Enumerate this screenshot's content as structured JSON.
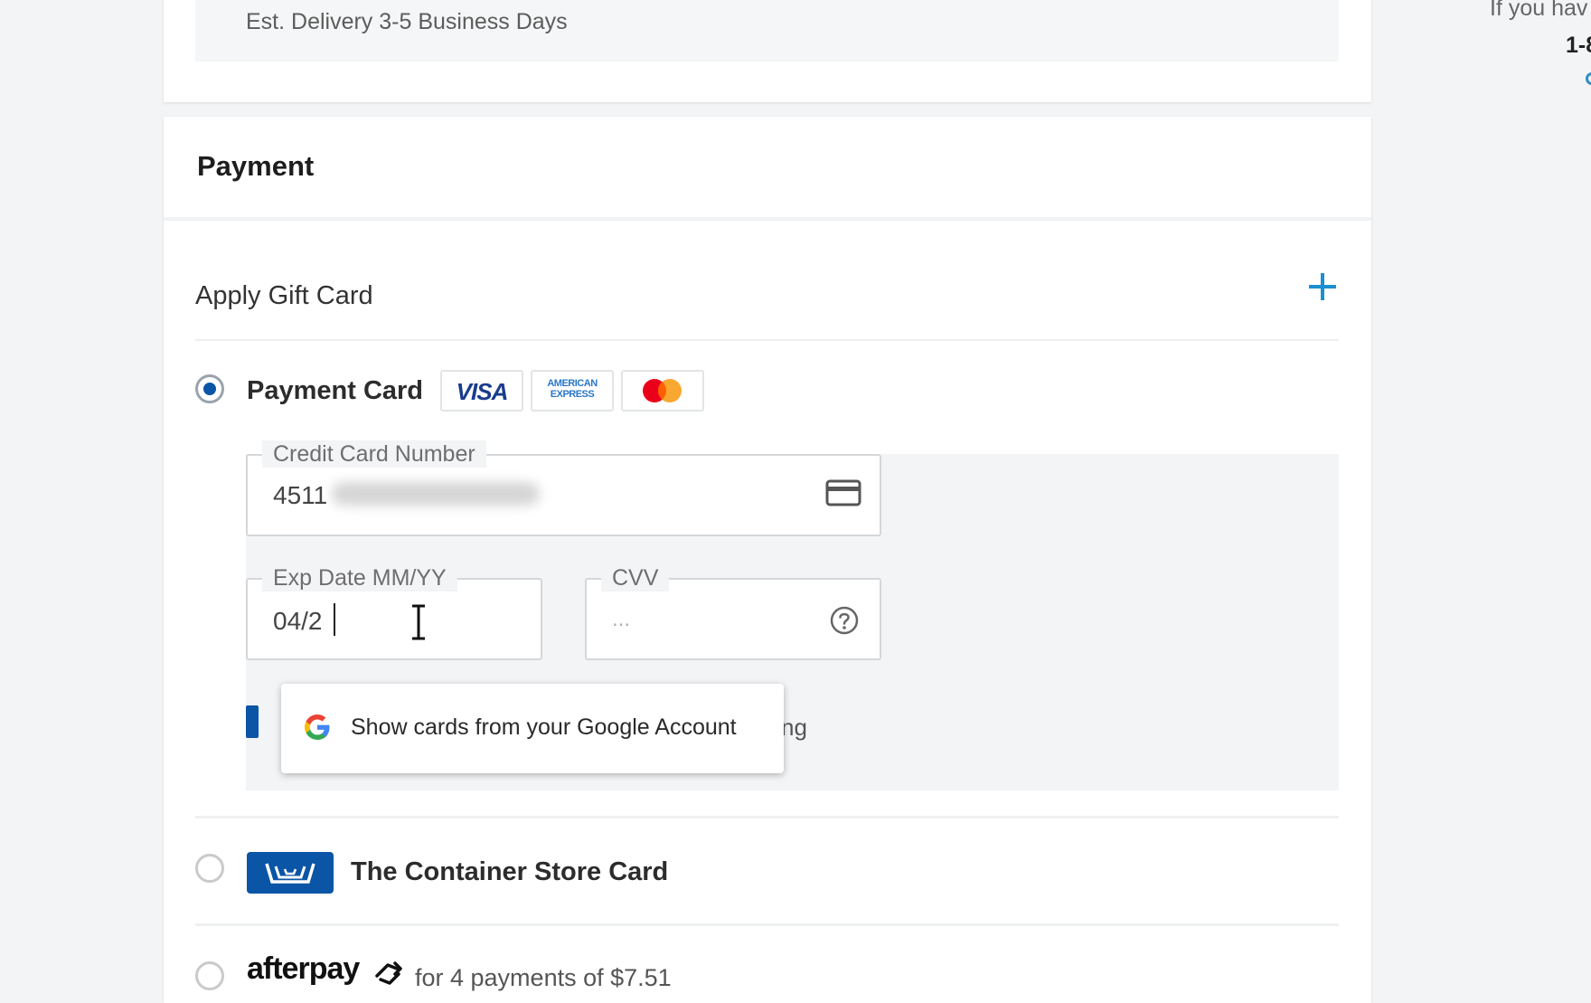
{
  "delivery": {
    "estimate": "Est. Delivery 3-5 Business Days"
  },
  "payment": {
    "title": "Payment",
    "gift_card": {
      "label": "Apply Gift Card",
      "icon": "plus-icon",
      "accent": "#1a8fd1"
    },
    "payment_card": {
      "label": "Payment Card",
      "selected": true,
      "brands": [
        "VISA",
        "AMERICAN EXPRESS",
        "mastercard"
      ],
      "brand_visa_text": "VISA",
      "brand_amex_line1": "AMERICAN",
      "brand_amex_line2": "EXPRESS",
      "fields": {
        "card_number": {
          "label": "Credit Card Number",
          "value": "4511"
        },
        "exp_date": {
          "label": "Exp Date MM/YY",
          "value": "04/2"
        },
        "cvv": {
          "label": "CVV",
          "placeholder": "..."
        }
      },
      "save_tail_text": "ng"
    },
    "autofill": {
      "text": "Show cards from your Google Account"
    },
    "store_card": {
      "label": "The Container Store Card",
      "selected": false
    },
    "afterpay": {
      "logo": "afterpay",
      "text": "for 4 payments of $7.51",
      "selected": false
    }
  },
  "side": {
    "text_1": "If you hav",
    "text_2": "1-8"
  },
  "colors": {
    "brand_blue": "#0a55a6",
    "accent": "#1a8fd1",
    "panel": "#f3f4f6"
  }
}
